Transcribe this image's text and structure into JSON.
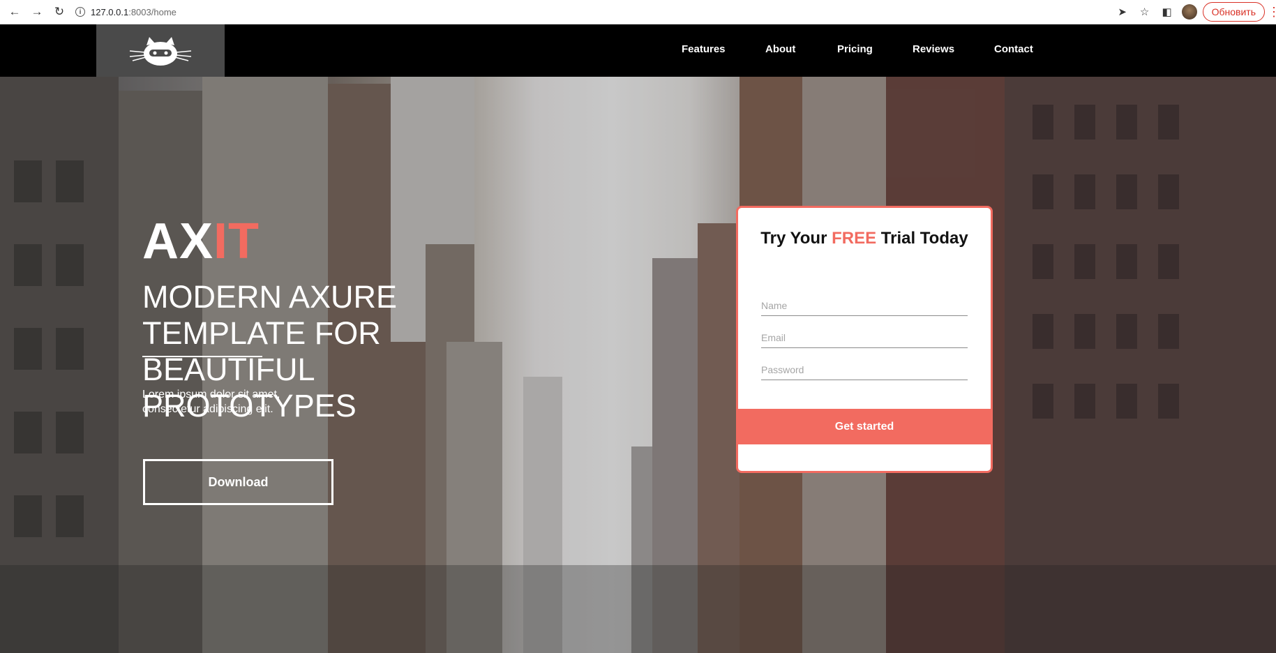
{
  "browser": {
    "url_host": "127.0.0.1",
    "url_path": ":8003/home",
    "update_label": "Обновить"
  },
  "nav": {
    "items": [
      {
        "label": "Features"
      },
      {
        "label": "About"
      },
      {
        "label": "Pricing"
      },
      {
        "label": "Reviews"
      },
      {
        "label": "Contact"
      }
    ]
  },
  "hero": {
    "title_main": "AX",
    "title_accent": "IT",
    "subtitle": "MODERN AXURE TEMPLATE FOR\nBEAUTIFUL PROTOTYPES",
    "body": "Lorem ipsum dolor sit amet,\nconsectetur adipiscing elit.",
    "download_label": "Download"
  },
  "trial": {
    "title_before": "Try Your ",
    "title_accent": "FREE",
    "title_after": " Trial Today",
    "name_placeholder": "Name",
    "email_placeholder": "Email",
    "password_placeholder": "Password",
    "cta_label": "Get started"
  },
  "colors": {
    "accent": "#f26b60",
    "header_bg": "#000000",
    "logo_bg": "#4a4a4a"
  }
}
